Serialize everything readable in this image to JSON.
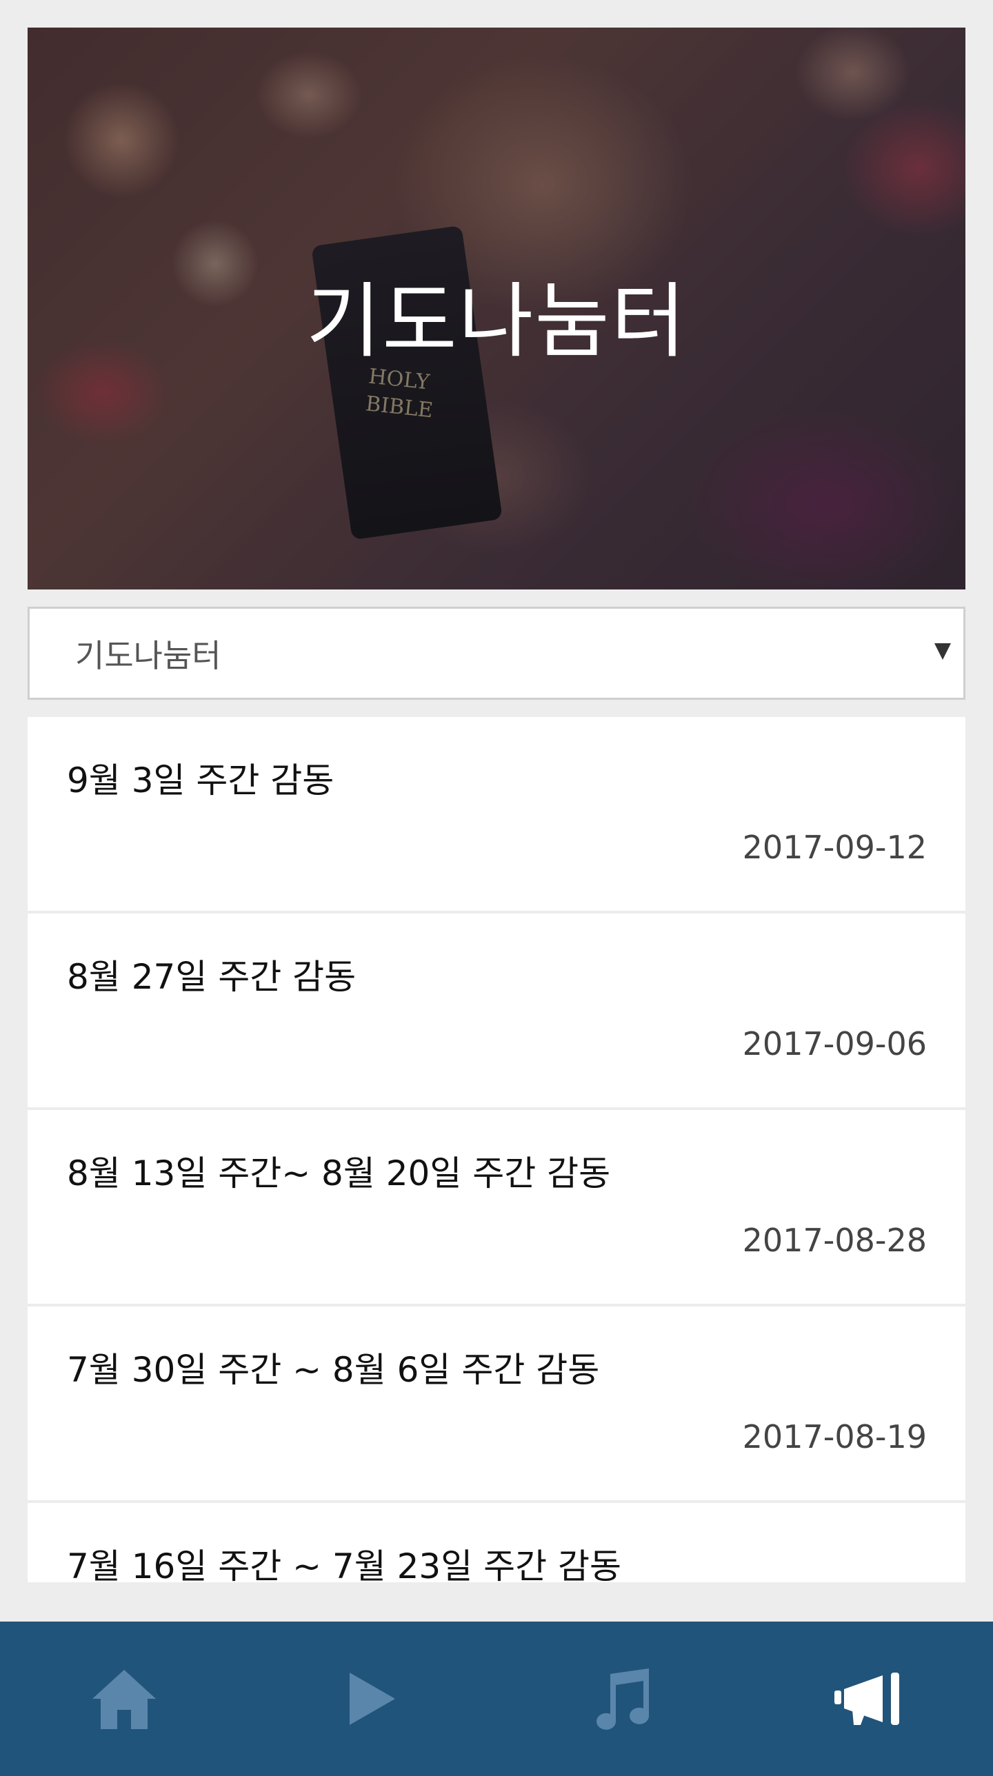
{
  "hero": {
    "title": "기도나눔터",
    "bible_text_line1": "HOLY",
    "bible_text_line2": "BIBLE"
  },
  "board_select": {
    "selected": "기도나눔터"
  },
  "posts": [
    {
      "title": "9월 3일 주간 감동",
      "date": "2017-09-12"
    },
    {
      "title": "8월 27일 주간 감동",
      "date": "2017-09-06"
    },
    {
      "title": "8월 13일 주간~ 8월 20일 주간 감동",
      "date": "2017-08-28"
    },
    {
      "title": "7월 30일 주간 ~ 8월 6일 주간 감동",
      "date": "2017-08-19"
    },
    {
      "title": "7월 16일 주간 ~ 7월 23일 주간 감동",
      "date": ""
    }
  ],
  "bottom_nav": {
    "items": [
      {
        "icon": "home-icon",
        "active": false
      },
      {
        "icon": "play-icon",
        "active": false
      },
      {
        "icon": "music-note-icon",
        "active": false
      },
      {
        "icon": "megaphone-icon",
        "active": true
      }
    ],
    "colors": {
      "background": "#21547a",
      "inactive": "#5b86ab",
      "active": "#ffffff"
    }
  }
}
